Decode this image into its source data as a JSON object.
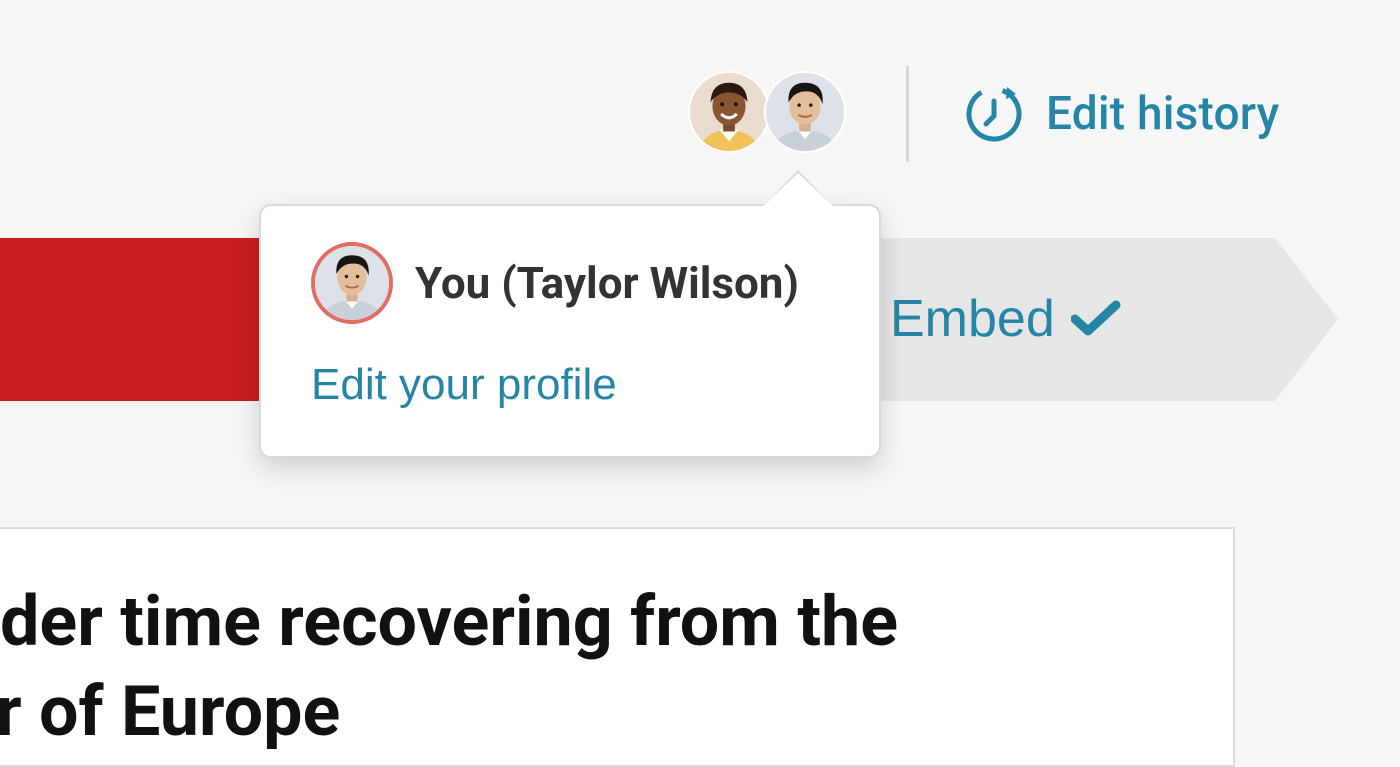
{
  "header": {
    "collaborators": [
      {
        "name": "collaborator-1"
      },
      {
        "name": "you"
      }
    ],
    "edit_history_label": "Edit history",
    "icons": {
      "edit_history": "history-clock-icon"
    }
  },
  "steps": {
    "embed_label": "Embed",
    "embed_status_icon": "checkmark-icon"
  },
  "popover": {
    "user_name": "You (Taylor Wilson)",
    "edit_profile_label": "Edit your profile"
  },
  "content": {
    "headline_line1": "der time recovering from the",
    "headline_line2": "r of Europe"
  },
  "colors": {
    "accent": "#2585a6",
    "step_active": "#c71d1d",
    "step_inactive": "#e6e6e6",
    "avatar_ring": "#e16e62"
  }
}
